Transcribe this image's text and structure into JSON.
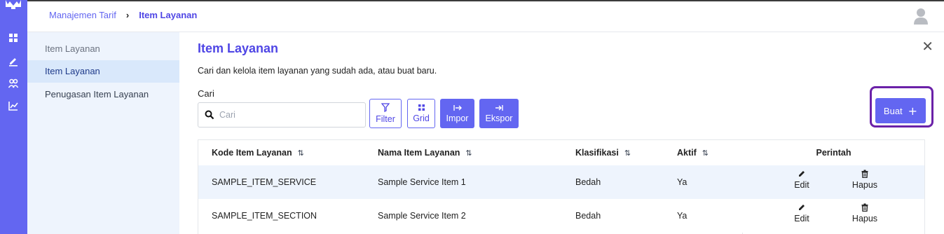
{
  "breadcrumb": {
    "parent": "Manajemen Tarif",
    "current": "Item Layanan"
  },
  "sidebar": {
    "items": [
      {
        "label": "Item Layanan"
      },
      {
        "label": "Item Layanan"
      },
      {
        "label": "Penugasan Item Layanan"
      }
    ]
  },
  "main": {
    "title": "Item Layanan",
    "description": "Cari dan kelola item layanan yang sudah ada, atau buat baru.",
    "search_label": "Cari",
    "search_placeholder": "Cari",
    "search_value": ""
  },
  "toolbar": {
    "filter": "Filter",
    "grid": "Grid",
    "import": "Impor",
    "export": "Ekspor",
    "create": "Buat"
  },
  "table": {
    "headers": {
      "code": "Kode Item Layanan",
      "name": "Nama Item Layanan",
      "class": "Klasifikasi",
      "active": "Aktif",
      "commands": "Perintah"
    },
    "rows": [
      {
        "code": "SAMPLE_ITEM_SERVICE",
        "name": "Sample Service Item 1",
        "class": "Bedah",
        "active": "Ya",
        "edit": "Edit",
        "delete": "Hapus"
      },
      {
        "code": "SAMPLE_ITEM_SECTION",
        "name": "Sample Service Item 2",
        "class": "Bedah",
        "active": "Ya",
        "edit": "Edit",
        "delete": "Hapus"
      }
    ]
  },
  "colors": {
    "accent": "#6366f1",
    "accent_dark": "#4f46e5",
    "highlight_border": "#6b21a8",
    "sidebar_bg": "#eef4fd",
    "row_highlight": "#eef4fd"
  },
  "icons": [
    "app-logo-icon",
    "dashboard-icon",
    "edit-nav-icon",
    "users-icon",
    "chart-icon",
    "avatar-icon",
    "close-icon",
    "search-icon",
    "filter-icon",
    "grid-icon",
    "import-icon",
    "export-icon",
    "plus-icon",
    "sort-icon",
    "pencil-icon",
    "trash-icon"
  ]
}
